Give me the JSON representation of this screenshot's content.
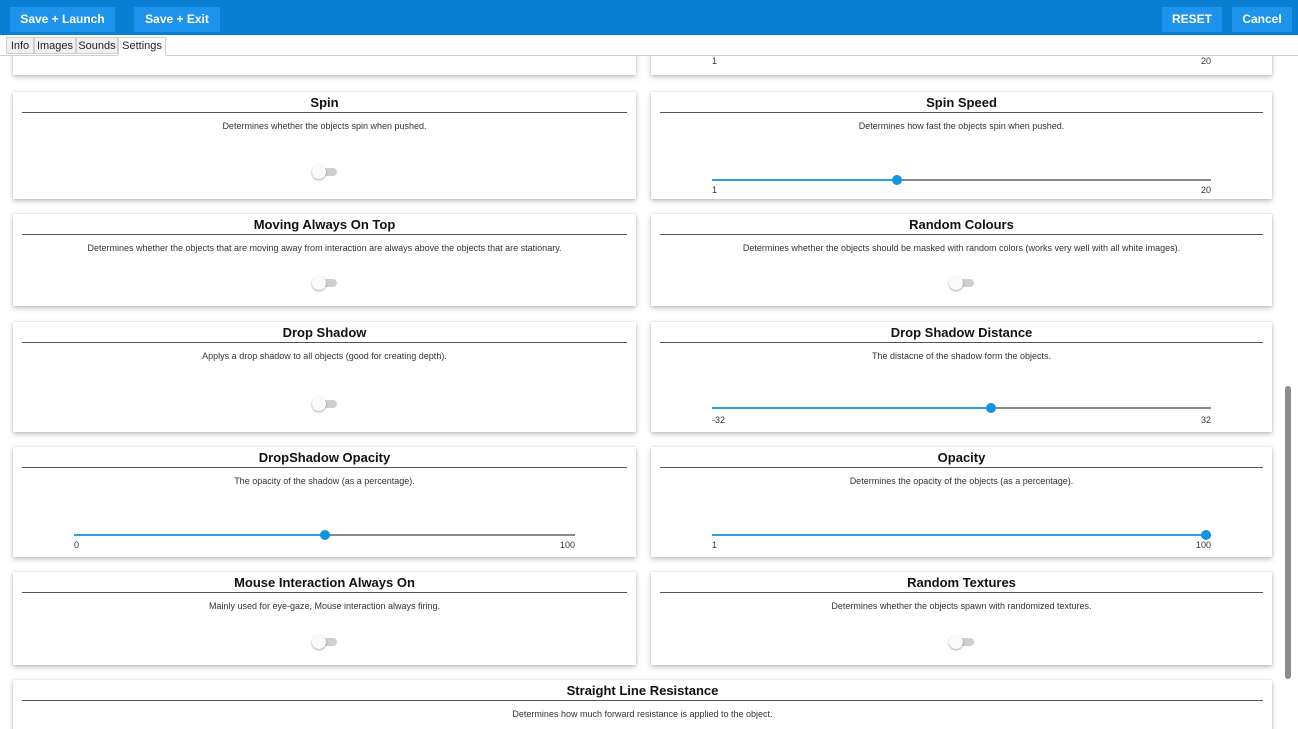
{
  "toolbar": {
    "save_launch": "Save + Launch",
    "save_exit": "Save + Exit",
    "reset": "RESET",
    "cancel": "Cancel"
  },
  "tabs": [
    "Info",
    "Images",
    "Sounds",
    "Settings"
  ],
  "active_tab": "Settings",
  "colors": {
    "accent": "#0a7fd1",
    "button": "#1e93ec",
    "slider": "#26a3e8"
  },
  "settings": {
    "partial_slider": {
      "min": "1",
      "max": "20"
    },
    "spin": {
      "title": "Spin",
      "description": "Determines whether the objects spin when pushed.",
      "enabled": false
    },
    "spin_speed": {
      "title": "Spin Speed",
      "description": "Determines how fast the objects spin when pushed.",
      "min": "1",
      "max": "20",
      "value_fraction": 0.37
    },
    "moving_on_top": {
      "title": "Moving Always On Top",
      "description": "Determines whether the objects that are moving away from interaction are always above the objects that are stationary.",
      "enabled": false
    },
    "random_colours": {
      "title": "Random Colours",
      "description": "Determines whether the objects should be masked with random colors (works very well with all white images).",
      "enabled": false
    },
    "drop_shadow": {
      "title": "Drop Shadow",
      "description": "Applys a drop shadow to all objects (good for creating depth).",
      "enabled": false
    },
    "drop_shadow_distance": {
      "title": "Drop Shadow Distance",
      "description": "The distacne of the shadow form the objects.",
      "min": "-32",
      "max": "32",
      "value_fraction": 0.56
    },
    "dropshadow_opacity": {
      "title": "DropShadow Opacity",
      "description": "The opacity of the shadow (as a percentage).",
      "min": "0",
      "max": "100",
      "value_fraction": 0.5
    },
    "opacity": {
      "title": "Opacity",
      "description": "Determines the opacity of the objects (as a percentage).",
      "min": "1",
      "max": "100",
      "value_fraction": 0.99
    },
    "mouse_interaction": {
      "title": "Mouse Interaction Always On",
      "description": "Mainly used for eye-gaze, Mouse interaction always firing.",
      "enabled": false
    },
    "random_textures": {
      "title": "Random Textures",
      "description": "Determines whether the objects spawn with randomized textures.",
      "enabled": false
    },
    "straight_line_resistance": {
      "title": "Straight Line Resistance",
      "description": "Determines how much forward resistance is applied to the object."
    }
  }
}
